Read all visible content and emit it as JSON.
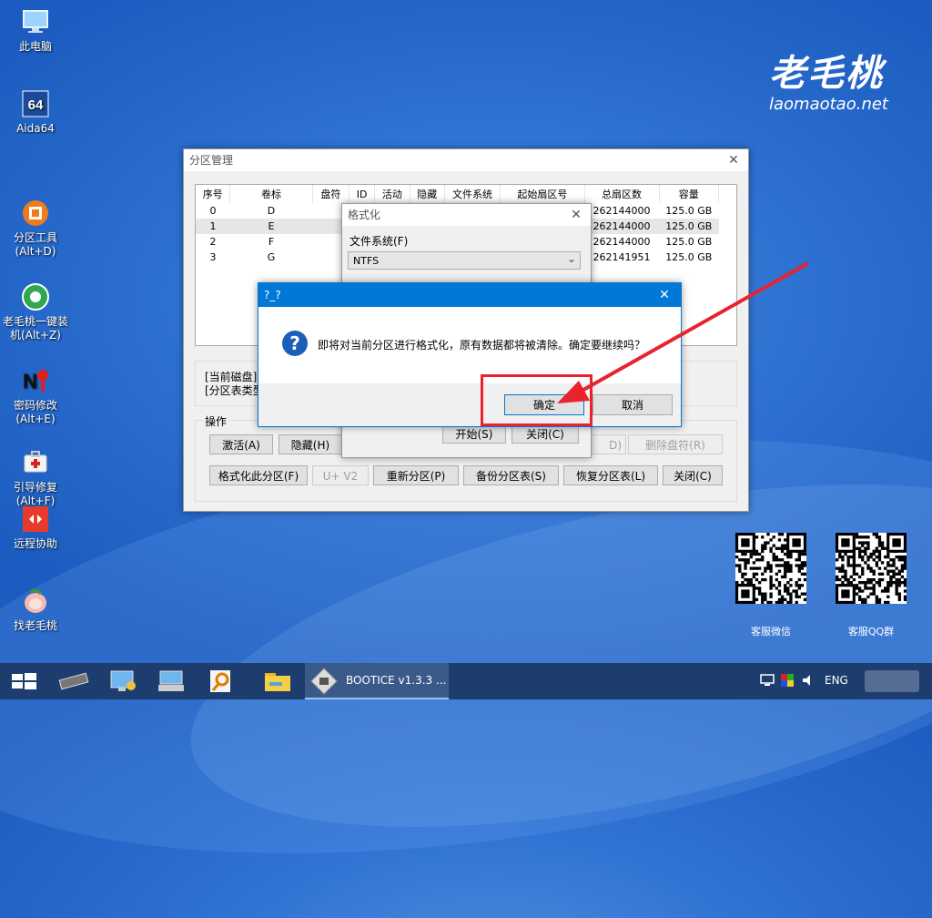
{
  "desktop_icons": [
    {
      "label": "此电脑",
      "icon": "computer-icon"
    },
    {
      "label": "Aida64",
      "icon": "aida64-icon"
    },
    {
      "label": "分区工具\n(Alt+D)",
      "icon": "partition-tool-icon"
    },
    {
      "label": "老毛桃一键装\n机(Alt+Z)",
      "icon": "installer-icon"
    },
    {
      "label": "密码修改\n(Alt+E)",
      "icon": "password-icon"
    },
    {
      "label": "引导修复\n(Alt+F)",
      "icon": "boot-repair-icon"
    },
    {
      "label": "远程协助",
      "icon": "remote-help-icon"
    },
    {
      "label": "找老毛桃",
      "icon": "peach-icon"
    }
  ],
  "logo": {
    "text": "老毛桃",
    "url": "laomaotao.net"
  },
  "qr": [
    {
      "caption": "客服微信"
    },
    {
      "caption": "客服QQ群"
    }
  ],
  "partition_window": {
    "title": "分区管理",
    "columns": [
      "序号",
      "卷标",
      "盘符",
      "ID",
      "活动",
      "隐藏",
      "文件系统",
      "起始扇区号",
      "总扇区数",
      "容量"
    ],
    "rows": [
      {
        "num": "0",
        "label": "D",
        "total": "262144000",
        "cap": "125.0 GB"
      },
      {
        "num": "1",
        "label": "E",
        "total": "262144000",
        "cap": "125.0 GB"
      },
      {
        "num": "2",
        "label": "F",
        "total": "262144000",
        "cap": "125.0 GB"
      },
      {
        "num": "3",
        "label": "G",
        "total": "262141951",
        "cap": "125.0 GB"
      }
    ],
    "info_line1": "[当前磁盘]",
    "info_line2": "[分区表类型",
    "ops_label": "操作",
    "buttons_row1": {
      "activate": "激活(A)",
      "hide": "隐藏(H)",
      "assign_tail": "D)",
      "delete_letter": "删除盘符(R)"
    },
    "buttons_row2": {
      "format": "格式化此分区(F)",
      "uv2": "U+ V2",
      "repartition": "重新分区(P)",
      "backup": "备份分区表(S)",
      "restore": "恢复分区表(L)",
      "close": "关闭(C)"
    }
  },
  "format_window": {
    "title": "格式化",
    "fs_label": "文件系统(F)",
    "fs_value": "NTFS",
    "start": "开始(S)",
    "close": "关闭(C)"
  },
  "confirm_dialog": {
    "title": "?_?",
    "message": "即将对当前分区进行格式化，原有数据都将被清除。确定要继续吗？",
    "ok": "确定",
    "cancel": "取消"
  },
  "taskbar": {
    "active_app": "BOOTICE v1.3.3 ...",
    "lang": "ENG"
  },
  "colors": {
    "accent": "#0078d7",
    "annotation": "#e8232d",
    "taskbar": "#1c3d6e"
  }
}
